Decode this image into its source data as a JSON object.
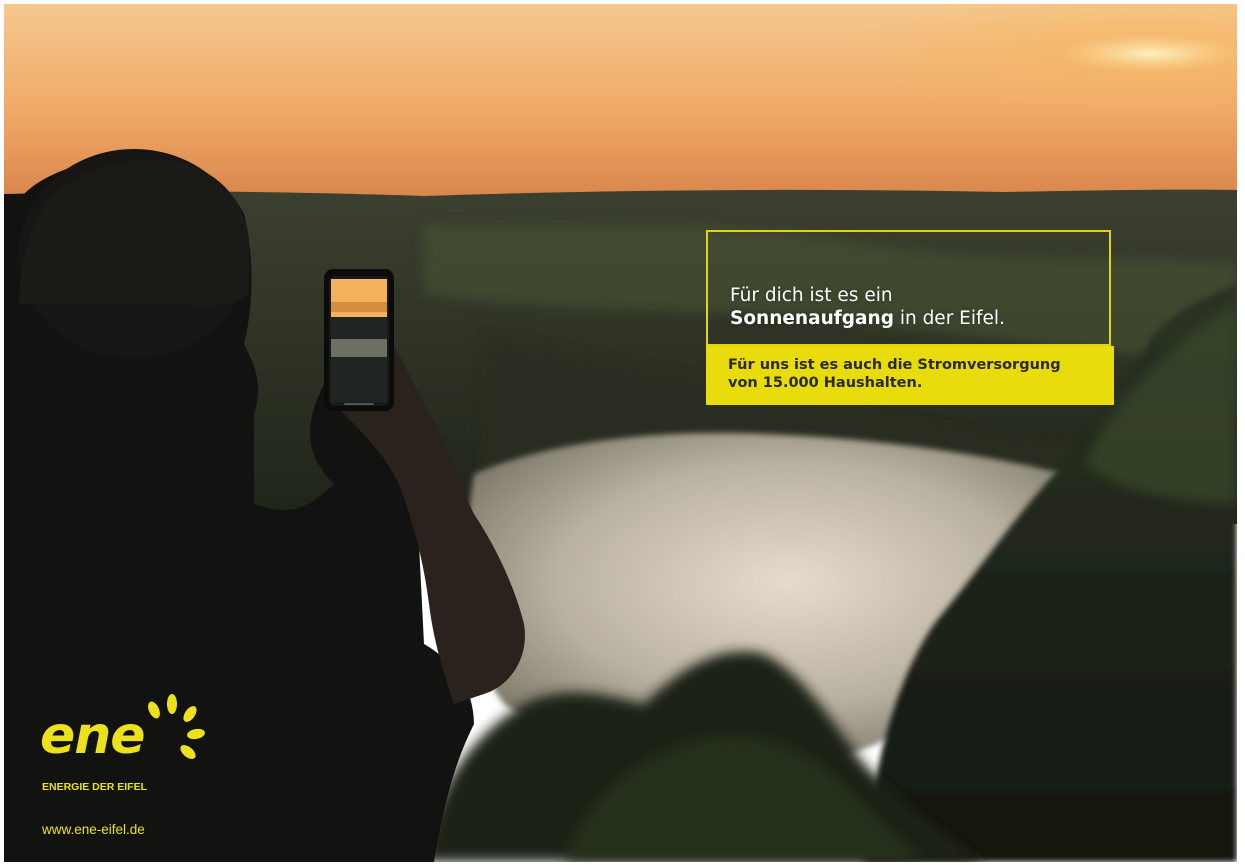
{
  "headline": {
    "line1": "Für dich ist es ein",
    "line2_bold": "Sonnenaufgang",
    "line2_rest": " in der Eifel."
  },
  "subline": {
    "line1": "Für uns ist es auch die Stromversorgung",
    "line2": "von 15.000 Haushalten."
  },
  "logo": {
    "wordmark": "ene",
    "tagline": "ENERGIE DER EIFEL",
    "icon": "sun-rays-icon"
  },
  "url": "www.ene-eifel.de",
  "colors": {
    "brand_yellow": "#e8dc0c",
    "headline_text": "#ffffff",
    "subline_text": "#2b2a1e"
  }
}
